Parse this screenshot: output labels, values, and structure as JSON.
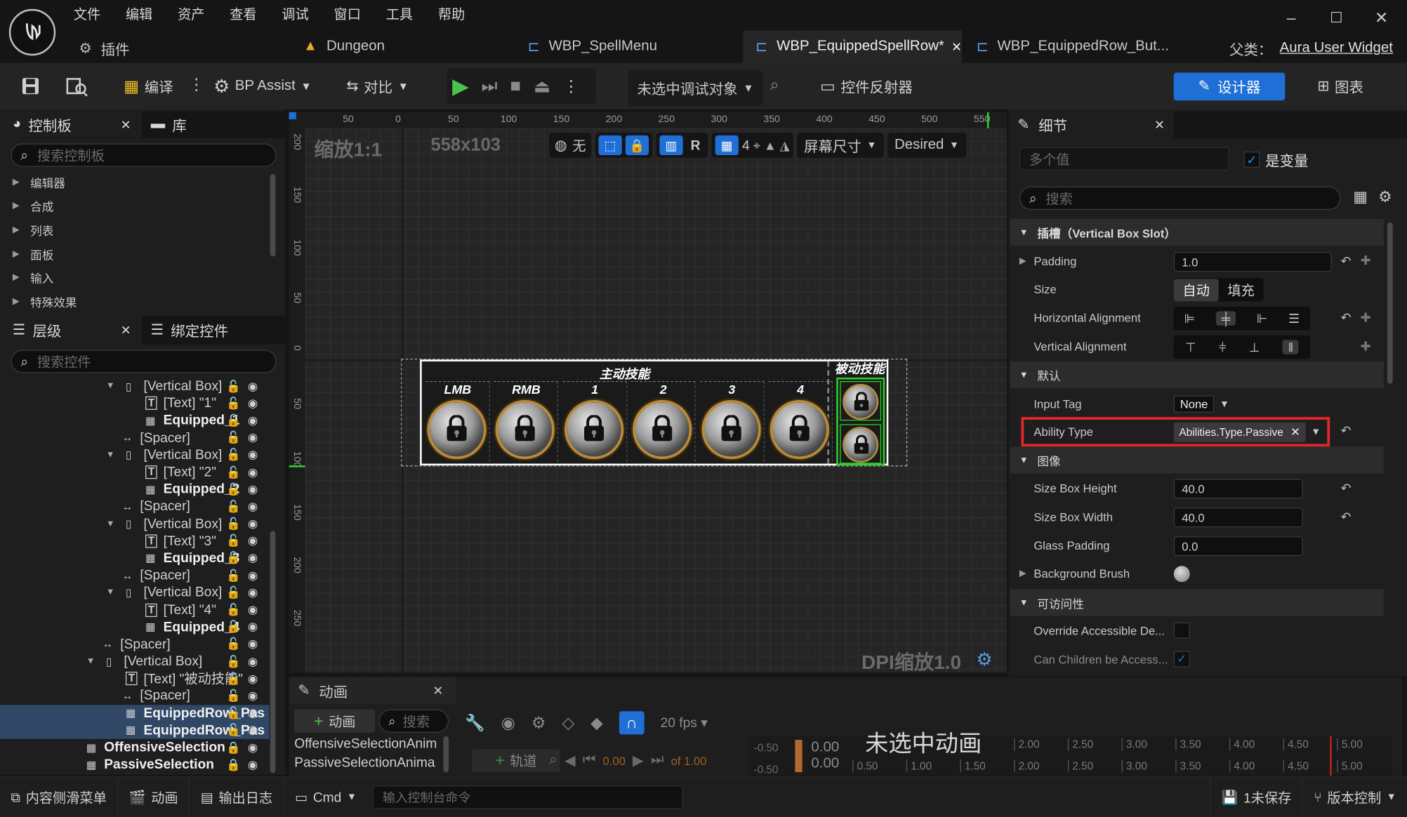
{
  "window": {
    "menu": [
      "文件",
      "编辑",
      "资产",
      "查看",
      "调试",
      "窗口",
      "工具",
      "帮助"
    ],
    "plugin_label": "插件",
    "tabs": [
      "Dungeon",
      "WBP_SpellMenu",
      "WBP_EquippedSpellRow*",
      "WBP_EquippedRow_But..."
    ],
    "parent_label": "父类：",
    "parent_value": "Aura User Widget",
    "controls": {
      "minimize": "–",
      "maximize": "☐",
      "close": "✕"
    }
  },
  "toolbar": {
    "compile": "编译",
    "bp_assist": "BP Assist",
    "diff": "对比",
    "debug_target": "未选中调试对象",
    "widget_reflector": "控件反射器",
    "designer": "设计器",
    "graph": "图表"
  },
  "palette": {
    "title": "控制板",
    "library": "库",
    "search_placeholder": "搜索控制板",
    "categories": [
      "编辑器",
      "合成",
      "列表",
      "面板",
      "输入",
      "特殊效果"
    ]
  },
  "hierarchy": {
    "title": "层级",
    "bind_title": "绑定控件",
    "search_placeholder": "搜索控件",
    "rows": [
      {
        "text": "[Vertical Box]",
        "indent": 1,
        "arrow": true,
        "kind": "vbox"
      },
      {
        "text": "[Text] \"1\"",
        "indent": 2,
        "kind": "text"
      },
      {
        "text": "Equipped_1",
        "indent": 2,
        "kind": "widget",
        "bold": true
      },
      {
        "text": "[Spacer]",
        "indent": 1,
        "kind": "spacer"
      },
      {
        "text": "[Vertical Box]",
        "indent": 1,
        "arrow": true,
        "kind": "vbox"
      },
      {
        "text": "[Text] \"2\"",
        "indent": 2,
        "kind": "text"
      },
      {
        "text": "Equipped_2",
        "indent": 2,
        "kind": "widget",
        "bold": true
      },
      {
        "text": "[Spacer]",
        "indent": 1,
        "kind": "spacer"
      },
      {
        "text": "[Vertical Box]",
        "indent": 1,
        "arrow": true,
        "kind": "vbox"
      },
      {
        "text": "[Text] \"3\"",
        "indent": 2,
        "kind": "text"
      },
      {
        "text": "Equipped_3",
        "indent": 2,
        "kind": "widget",
        "bold": true
      },
      {
        "text": "[Spacer]",
        "indent": 1,
        "kind": "spacer"
      },
      {
        "text": "[Vertical Box]",
        "indent": 1,
        "arrow": true,
        "kind": "vbox"
      },
      {
        "text": "[Text] \"4\"",
        "indent": 2,
        "kind": "text"
      },
      {
        "text": "Equipped_4",
        "indent": 2,
        "kind": "widget",
        "bold": true
      },
      {
        "text": "[Spacer]",
        "indent": 0,
        "kind": "spacer"
      },
      {
        "text": "[Vertical Box]",
        "indent": 0,
        "arrow": true,
        "kind": "vbox"
      },
      {
        "text": "[Text] \"被动技能\"",
        "indent": 1,
        "kind": "text"
      },
      {
        "text": "[Spacer]",
        "indent": 1,
        "kind": "spacer"
      },
      {
        "text": "EquippedRow_Pas",
        "indent": 1,
        "kind": "widget",
        "bold": true,
        "selected": true
      },
      {
        "text": "EquippedRow_Pas",
        "indent": 1,
        "kind": "widget",
        "bold": true,
        "selected": true
      },
      {
        "text": "OffensiveSelection",
        "indent": -1,
        "kind": "widget",
        "bold": true,
        "locked": true
      },
      {
        "text": "PassiveSelection",
        "indent": -1,
        "kind": "widget",
        "bold": true,
        "locked": true
      }
    ]
  },
  "canvas": {
    "zoom_label": "缩放1:1",
    "size_label": "558x103",
    "none_label": "无",
    "r_label": "R",
    "grid_count": "4",
    "screen_size": "屏幕尺寸",
    "desired": "Desired",
    "dpi_label": "DPI缩放1.0",
    "top_ruler": [
      "50",
      "0",
      "50",
      "100",
      "150",
      "200",
      "250",
      "300",
      "350",
      "400",
      "450",
      "500",
      "550"
    ],
    "side_ruler": [
      "200",
      "150",
      "100",
      "50",
      "0",
      "50",
      "100",
      "150",
      "200",
      "250"
    ],
    "active_title": "主动技能",
    "passive_title": "被动技能",
    "slot_labels": [
      "LMB",
      "RMB",
      "1",
      "2",
      "3",
      "4"
    ]
  },
  "details": {
    "title": "细节",
    "multi_value": "多个值",
    "is_variable": "是变量",
    "search_placeholder": "搜索",
    "section_slot": "插槽（Vertical Box Slot）",
    "padding_label": "Padding",
    "padding_value": "1.0",
    "size_label": "Size",
    "size_auto": "自动",
    "size_fill": "填充",
    "h_align": "Horizontal Alignment",
    "v_align": "Vertical Alignment",
    "section_default": "默认",
    "input_tag": "Input Tag",
    "input_tag_value": "None",
    "ability_type": "Ability Type",
    "ability_type_value": "Abilities.Type.Passive",
    "section_image": "图像",
    "size_box_height": "Size Box Height",
    "size_box_height_value": "40.0",
    "size_box_width": "Size Box Width",
    "size_box_width_value": "40.0",
    "glass_padding": "Glass Padding",
    "glass_padding_value": "0.0",
    "background_brush": "Background Brush",
    "section_access": "可访问性",
    "override_accessible": "Override Accessible De...",
    "can_children": "Can Children be Access..."
  },
  "animation": {
    "title": "动画",
    "add_anim": "动画",
    "search_placeholder": "搜索",
    "items": [
      "OffensiveSelectionAnim",
      "PassiveSelectionAnima"
    ],
    "track": "轨道",
    "fps": "20 fps",
    "no_anim": "未选中动画",
    "time_a": "0.00",
    "time_b": "0.00",
    "frame_display": "0.00",
    "of_label": "of",
    "frame_end": "1.00",
    "neg_time": "-0.50",
    "timeline_top": [
      "2.00",
      "2.50",
      "3.00",
      "3.50",
      "4.00",
      "4.50",
      "5.00"
    ],
    "timeline_bottom": [
      "0.50",
      "1.00",
      "1.50",
      "2.00",
      "2.50",
      "3.00",
      "3.50",
      "4.00",
      "4.50",
      "5.00"
    ]
  },
  "statusbar": {
    "content_drawer": "内容侧滑菜单",
    "animation": "动画",
    "output_log": "输出日志",
    "cmd": "Cmd",
    "console_placeholder": "输入控制台命令",
    "unsaved": "1未保存",
    "source_control": "版本控制"
  },
  "colors": {
    "accent_blue": "#1f6fd6",
    "highlight_red": "#e0262c",
    "passive_green": "#2bd12b",
    "selected_row": "#304766"
  }
}
